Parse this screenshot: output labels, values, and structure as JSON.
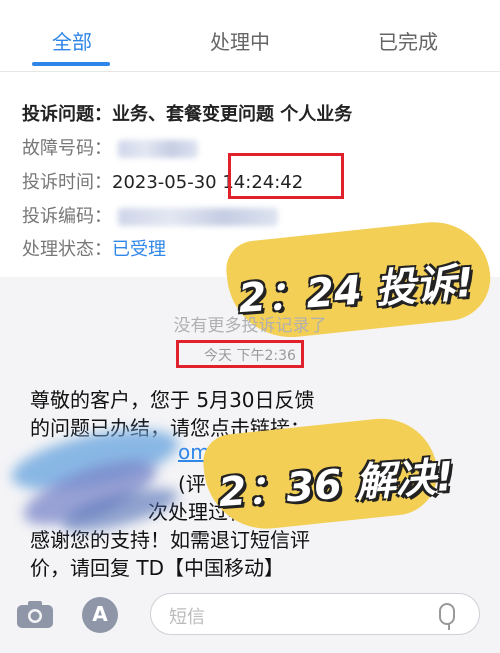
{
  "tabs": [
    {
      "label": "全部",
      "active": true
    },
    {
      "label": "处理中",
      "active": false
    },
    {
      "label": "已完成",
      "active": false
    }
  ],
  "complaint": {
    "issue_label": "投诉问题：",
    "issue_value": "业务、套餐变更问题 个人业务",
    "fault_label": "故障号码：",
    "time_label": "投诉时间：",
    "time_date": "2023-05-30",
    "time_clock": "14:24:42",
    "code_label": "投诉编码：",
    "status_label": "处理状态：",
    "status_value": "已受理"
  },
  "annotations": {
    "complaint_note": "2：24 投诉!",
    "resolved_note": "2：36 解决!"
  },
  "messages": {
    "no_more": "没有更多投诉记录了",
    "timestamp": "今天 下午2:36",
    "line1": "尊敬的客户，您于 5月30日反馈",
    "line2": "的问题已办结，请您点击链接：",
    "link_fragment": "omer.1",
    "line3_fragment": "(评",
    "line4_fragment": "次处理过程进行评价",
    "line5": "感谢您的支持！如需退订短信评",
    "line6": "价，请回复 TD【中国移动】"
  },
  "input": {
    "placeholder": "短信"
  },
  "icons": {
    "camera": "camera-icon",
    "apps": "app-store-icon",
    "mic": "microphone-icon"
  },
  "colors": {
    "accent": "#2f86e8",
    "highlight": "#f3cf55",
    "marker": "#e0202a"
  }
}
